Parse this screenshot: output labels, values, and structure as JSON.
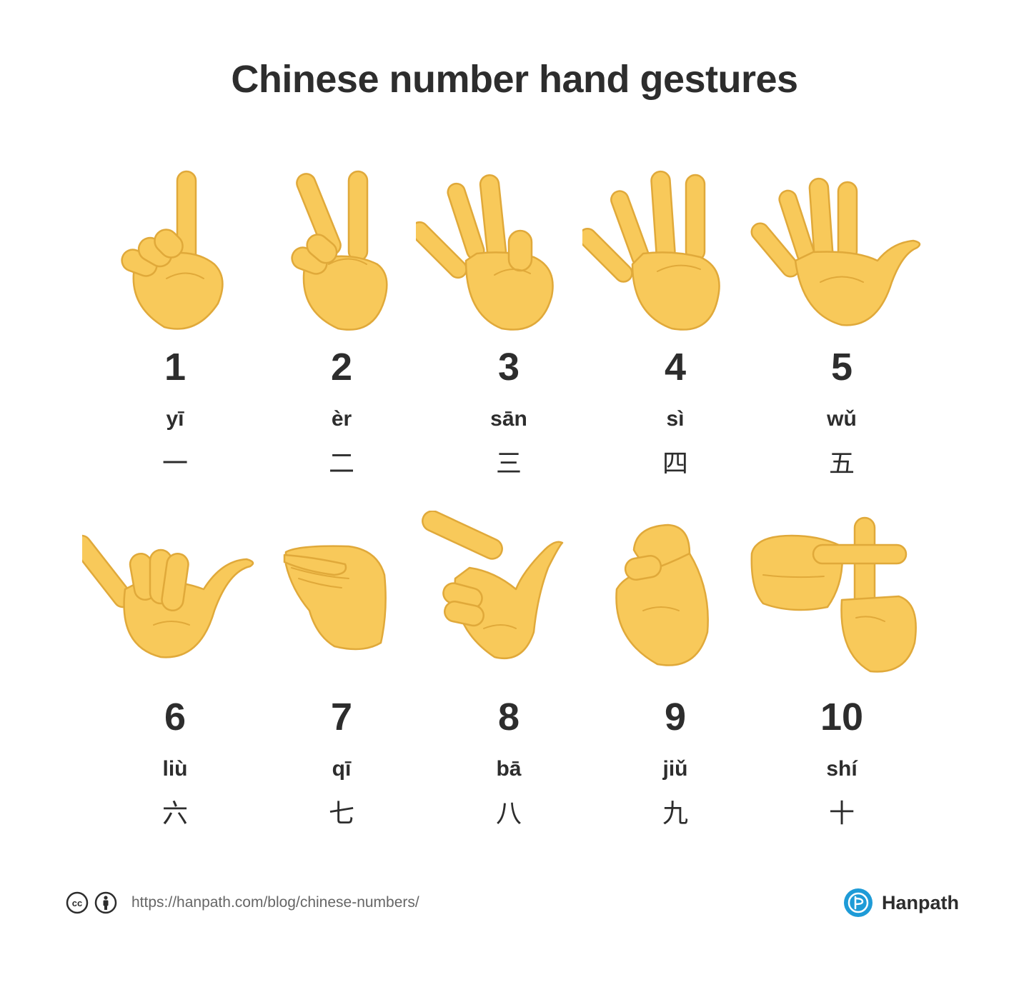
{
  "title": "Chinese number hand gestures",
  "numbers": [
    {
      "digit": "1",
      "pinyin": "yī",
      "hanzi": "一",
      "gesture": "hand-one-icon"
    },
    {
      "digit": "2",
      "pinyin": "èr",
      "hanzi": "二",
      "gesture": "hand-two-icon"
    },
    {
      "digit": "3",
      "pinyin": "sān",
      "hanzi": "三",
      "gesture": "hand-three-icon"
    },
    {
      "digit": "4",
      "pinyin": "sì",
      "hanzi": "四",
      "gesture": "hand-four-icon"
    },
    {
      "digit": "5",
      "pinyin": "wǔ",
      "hanzi": "五",
      "gesture": "hand-five-icon"
    },
    {
      "digit": "6",
      "pinyin": "liù",
      "hanzi": "六",
      "gesture": "hand-six-icon"
    },
    {
      "digit": "7",
      "pinyin": "qī",
      "hanzi": "七",
      "gesture": "hand-seven-icon"
    },
    {
      "digit": "8",
      "pinyin": "bā",
      "hanzi": "八",
      "gesture": "hand-eight-icon"
    },
    {
      "digit": "9",
      "pinyin": "jiǔ",
      "hanzi": "九",
      "gesture": "hand-nine-icon"
    },
    {
      "digit": "10",
      "pinyin": "shí",
      "hanzi": "十",
      "gesture": "hand-ten-icon"
    }
  ],
  "footer": {
    "license_icons": [
      "cc-icon",
      "attribution-icon"
    ],
    "url": "https://hanpath.com/blog/chinese-numbers/",
    "brand": "Hanpath",
    "brand_icon": "hanpath-logo-icon"
  },
  "colors": {
    "skin": "#f8c95a",
    "skin_outline": "#e0a93a",
    "text": "#2d2d2d",
    "brand": "#1e9bd7"
  }
}
